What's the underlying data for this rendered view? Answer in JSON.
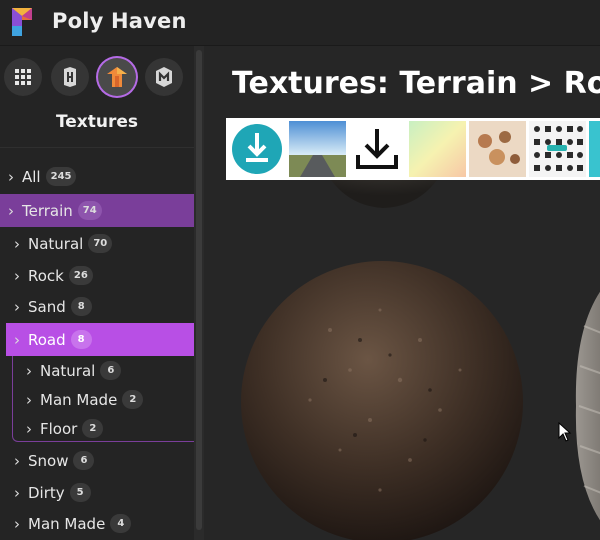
{
  "app": {
    "brand": "Poly Haven"
  },
  "asset_types": [
    {
      "icon": "grid-icon",
      "active": false
    },
    {
      "icon": "hdri-icon",
      "active": false
    },
    {
      "icon": "textures-icon",
      "active": true
    },
    {
      "icon": "models-icon",
      "active": false
    }
  ],
  "sidebar": {
    "title": "Textures",
    "categories": [
      {
        "label": "All",
        "count": "245"
      },
      {
        "label": "Terrain",
        "count": "74"
      },
      {
        "label": "Natural",
        "count": "70"
      },
      {
        "label": "Rock",
        "count": "26"
      },
      {
        "label": "Sand",
        "count": "8"
      },
      {
        "label": "Road",
        "count": "8"
      },
      {
        "label": "Natural",
        "count": "6"
      },
      {
        "label": "Man Made",
        "count": "2"
      },
      {
        "label": "Floor",
        "count": "2"
      },
      {
        "label": "Snow",
        "count": "6"
      },
      {
        "label": "Dirty",
        "count": "5"
      },
      {
        "label": "Man Made",
        "count": "4"
      }
    ]
  },
  "main": {
    "title": "Textures: Terrain > Road"
  },
  "colors": {
    "accent": "#b84fe5",
    "accent_dark": "#7a3e9a",
    "background": "#262626"
  }
}
